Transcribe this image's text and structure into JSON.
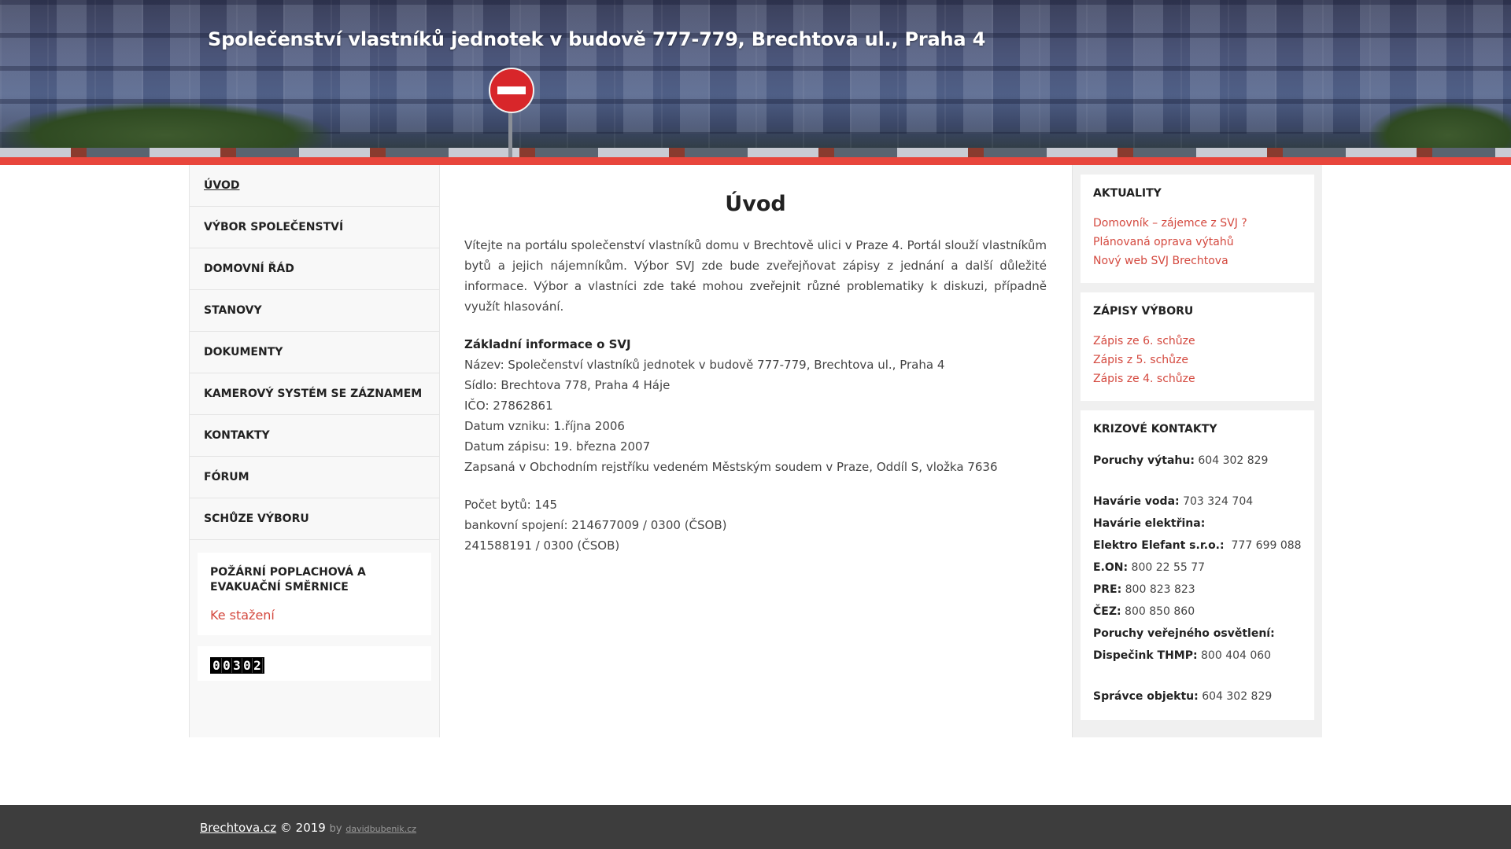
{
  "header": {
    "site_title": "Společenství vlastníků jednotek v budově 777-779, Brechtova ul., Praha 4"
  },
  "nav": {
    "items": [
      {
        "label": "ÚVOD",
        "active": true
      },
      {
        "label": "VÝBOR SPOLEČENSTVÍ"
      },
      {
        "label": "DOMOVNÍ ŘÁD"
      },
      {
        "label": "STANOVY"
      },
      {
        "label": "DOKUMENTY"
      },
      {
        "label": "KAMEROVÝ SYSTÉM SE ZÁZNAMEM"
      },
      {
        "label": "KONTAKTY"
      },
      {
        "label": "FÓRUM"
      },
      {
        "label": "SCHŮZE VÝBORU"
      }
    ]
  },
  "left_widget": {
    "title": "POŽÁRNÍ POPLACHOVÁ A EVAKUAČNÍ SMĚRNICE",
    "link": "Ke stažení"
  },
  "counter": {
    "digits": [
      "0",
      "0",
      "3",
      "0",
      "2"
    ]
  },
  "main": {
    "title": "Úvod",
    "intro": "Vítejte na portálu společenství vlastníků domu v Brechtově ulici v Praze 4. Portál slouží vlastníkům bytů a jejich nájemníkům. Výbor SVJ zde bude zveřejňovat zápisy z jednání a další důležité informace. Výbor a vlastníci zde také mohou zveřejnit různé problematiky k diskuzi, případně využít hlasování.",
    "info_heading": "Základní informace o SVJ",
    "info_lines": [
      "Název: Společenství vlastníků jednotek v budově 777-779, Brechtova ul., Praha 4",
      "Sídlo: Brechtova 778, Praha 4 Háje",
      "IČO: 27862861",
      "Datum vzniku: 1.října 2006",
      "Datum zápisu: 19. března 2007",
      "Zapsaná v Obchodním rejstříku vedeném Městským soudem v Praze, Oddíl S, vložka 7636"
    ],
    "extra_lines": [
      "Počet bytů: 145",
      "bankovní spojení: 214677009 / 0300 (ČSOB)",
      "241588191 / 0300 (ČSOB)"
    ]
  },
  "aktuality": {
    "title": "AKTUALITY",
    "links": [
      "Domovník – zájemce z SVJ ?",
      "Plánovaná oprava výtahů",
      "Nový web SVJ Brechtova"
    ]
  },
  "zapisy": {
    "title": "ZÁPISY VÝBORU",
    "links": [
      "Zápis ze 6. schůze",
      "Zápis z 5. schůze",
      "Zápis ze 4. schůze"
    ]
  },
  "krizove": {
    "title": "KRIZOVÉ KONTAKTY",
    "lines": [
      {
        "label": "Poruchy výtahu:",
        "value": " 604 302 829"
      },
      {
        "gap": true
      },
      {
        "label": "Havárie voda:",
        "value": " 703 324 704"
      },
      {
        "label": "Havárie elektřina:",
        "value": ""
      },
      {
        "label": "Elektro Elefant s.r.o.:",
        "value": "  777 699 088"
      },
      {
        "label": "E.ON:",
        "value": " 800 22 55 77"
      },
      {
        "label": "PRE:",
        "value": " 800 823 823"
      },
      {
        "label": "ČEZ:",
        "value": " 800 850 860"
      },
      {
        "label": "Poruchy veřejného osvětlení:",
        "value": ""
      },
      {
        "label": "Dispečink THMP:",
        "value": " 800 404 060"
      },
      {
        "gap": true
      },
      {
        "label": "Správce objektu:",
        "value": " 604 302 829"
      }
    ]
  },
  "footer": {
    "brand": "Brechtova.cz",
    "copyright": " © 2019 ",
    "by": "by",
    "author": "davidbubenik.cz"
  },
  "colors": {
    "accent": "#e8463c",
    "link": "#d4493f",
    "footer_bg": "#3d3d3d"
  }
}
